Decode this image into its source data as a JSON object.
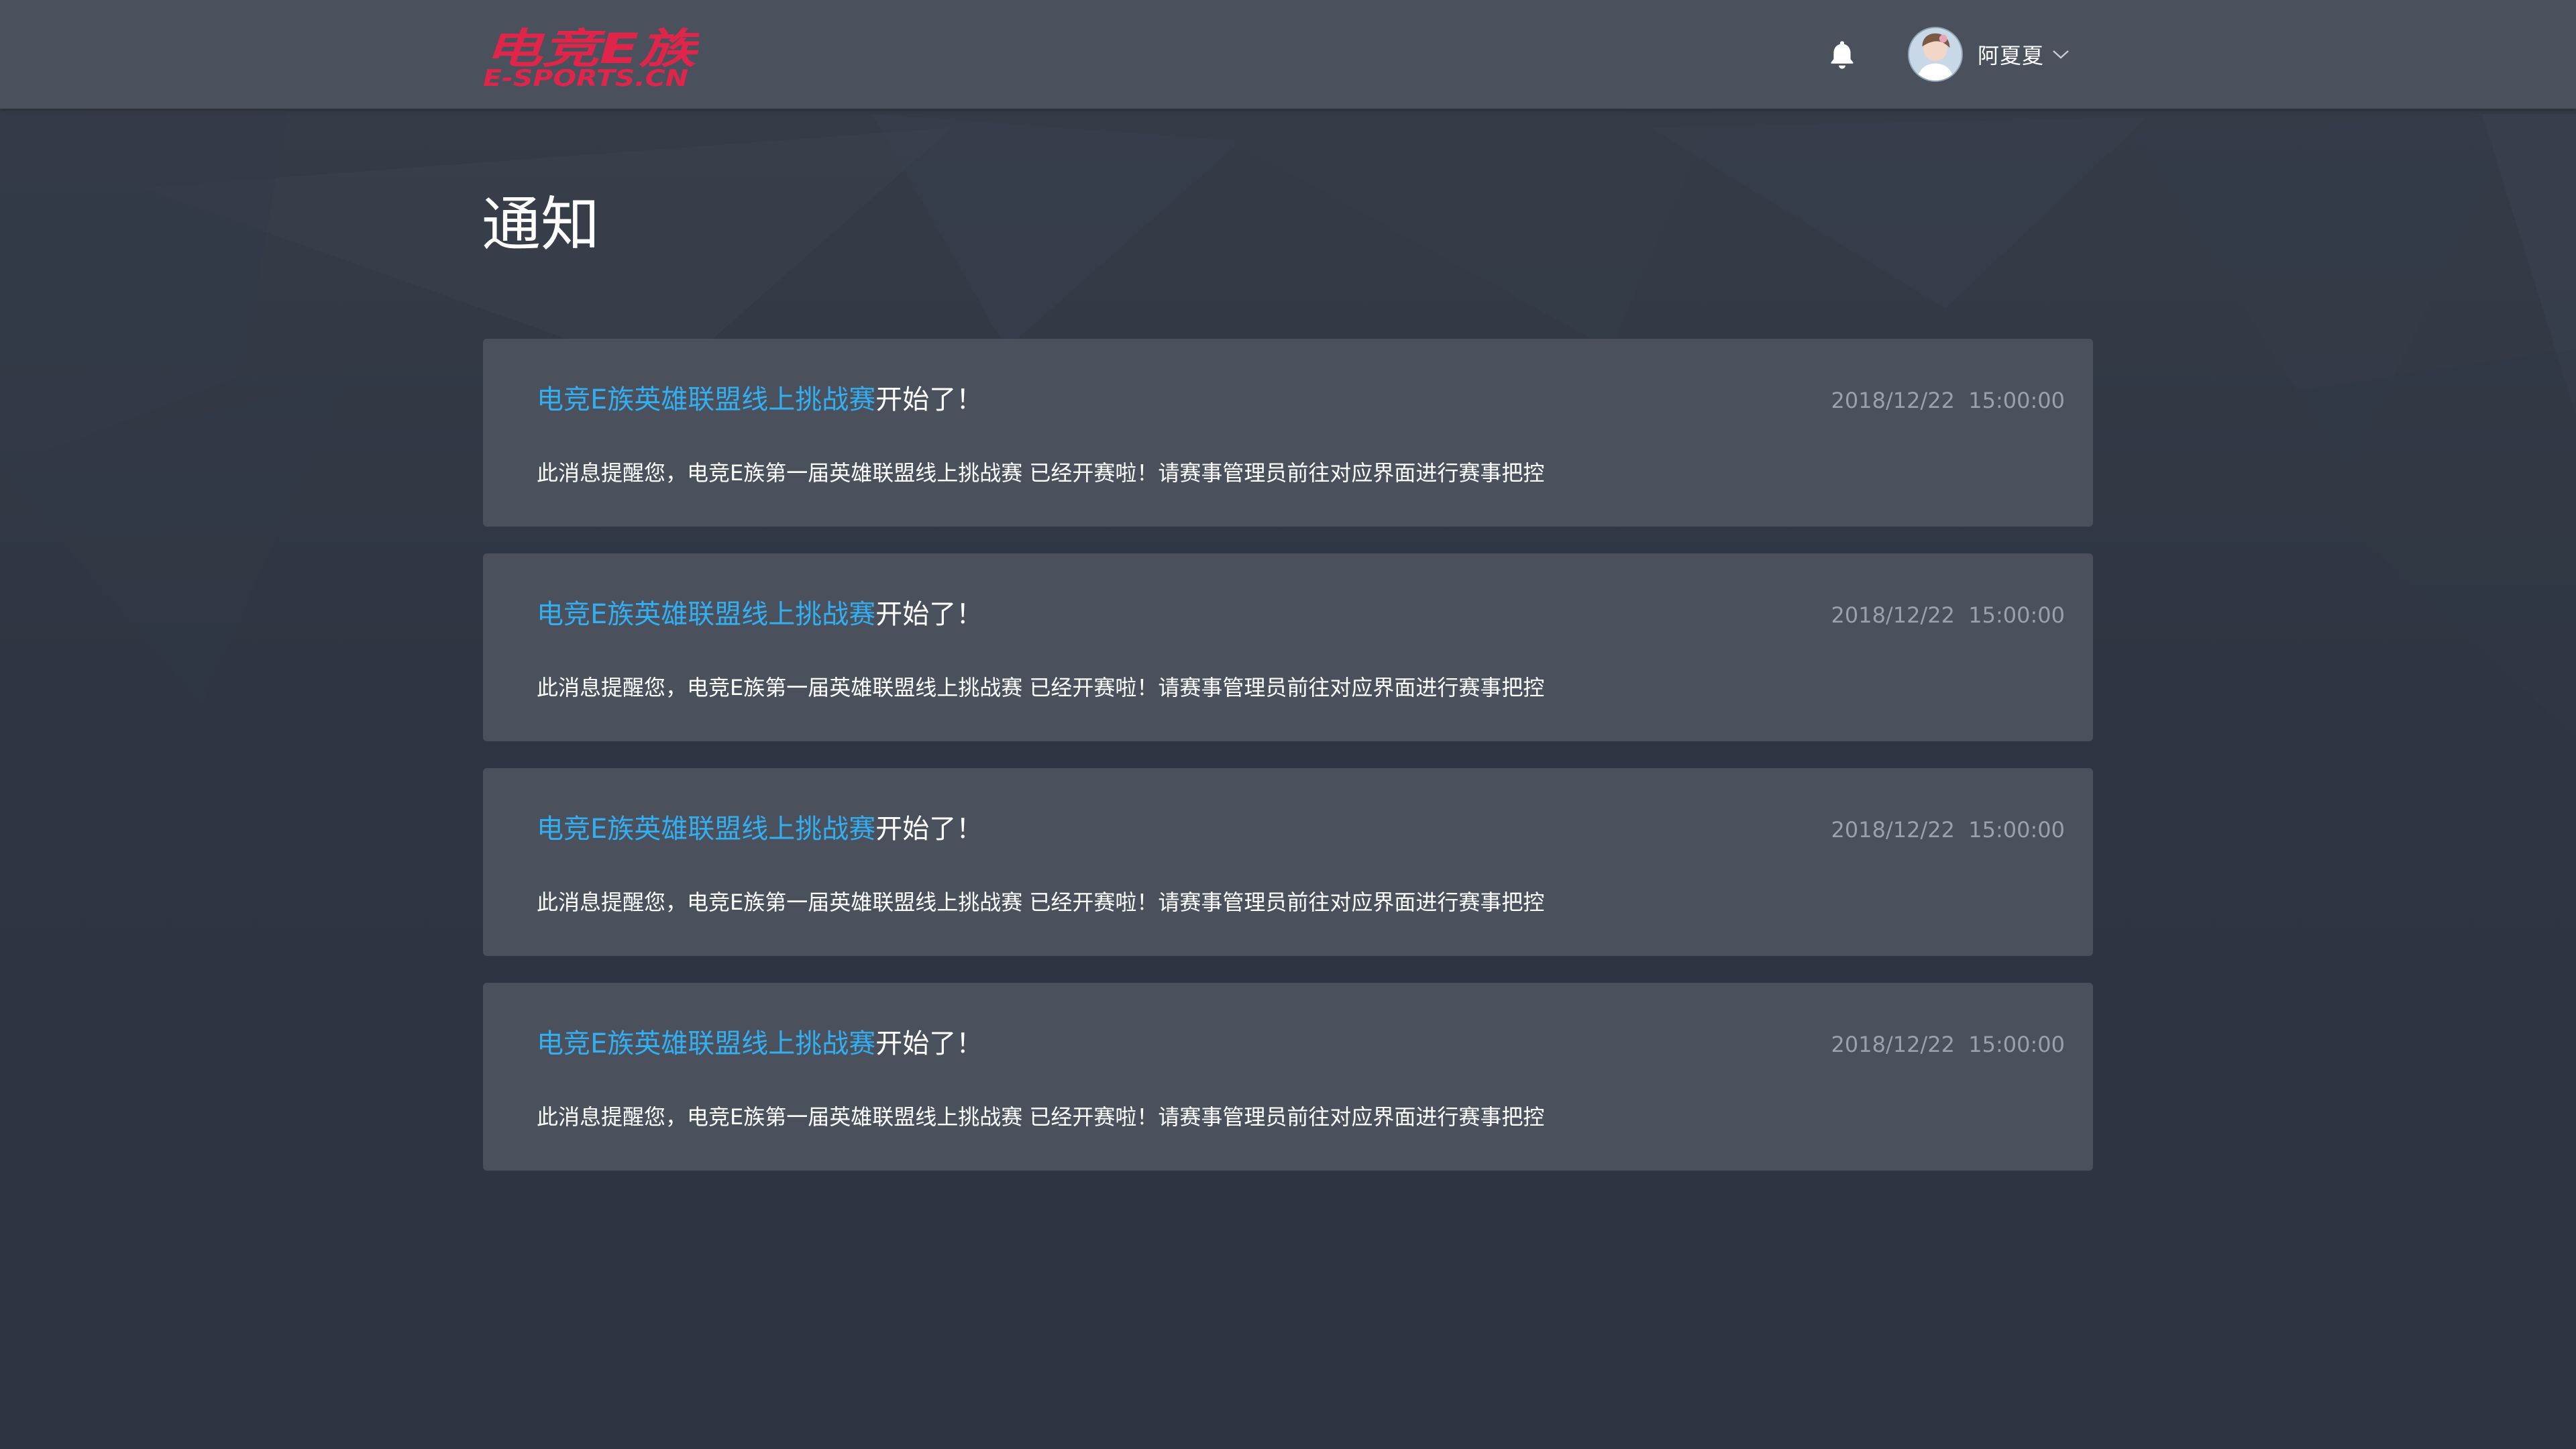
{
  "header": {
    "logo_main": "电竞E族",
    "logo_sub": "E-SPORTS.CN",
    "user_name": "阿夏夏"
  },
  "page": {
    "title": "通知"
  },
  "notifications": [
    {
      "title_link": "电竞E族英雄联盟线上挑战赛",
      "title_suffix": "开始了！",
      "time": "2018/12/22  15:00:00",
      "body": "此消息提醒您，电竞E族第一届英雄联盟线上挑战赛 已经开赛啦！请赛事管理员前往对应界面进行赛事把控"
    },
    {
      "title_link": "电竞E族英雄联盟线上挑战赛",
      "title_suffix": "开始了！",
      "time": "2018/12/22  15:00:00",
      "body": "此消息提醒您，电竞E族第一届英雄联盟线上挑战赛 已经开赛啦！请赛事管理员前往对应界面进行赛事把控"
    },
    {
      "title_link": "电竞E族英雄联盟线上挑战赛",
      "title_suffix": "开始了！",
      "time": "2018/12/22  15:00:00",
      "body": "此消息提醒您，电竞E族第一届英雄联盟线上挑战赛 已经开赛啦！请赛事管理员前往对应界面进行赛事把控"
    },
    {
      "title_link": "电竞E族英雄联盟线上挑战赛",
      "title_suffix": "开始了！",
      "time": "2018/12/22  15:00:00",
      "body": "此消息提醒您，电竞E族第一届英雄联盟线上挑战赛 已经开赛啦！请赛事管理员前往对应界面进行赛事把控"
    }
  ],
  "colors": {
    "brand": "#e0254b",
    "link": "#33aef0",
    "header_bg": "#4a515d",
    "card_bg": "#4a515d",
    "page_bg": "#2e3441",
    "time_text": "#9aa1ab"
  },
  "icons": {
    "notifications": "bell-icon",
    "user_menu": "chevron-down-icon"
  }
}
